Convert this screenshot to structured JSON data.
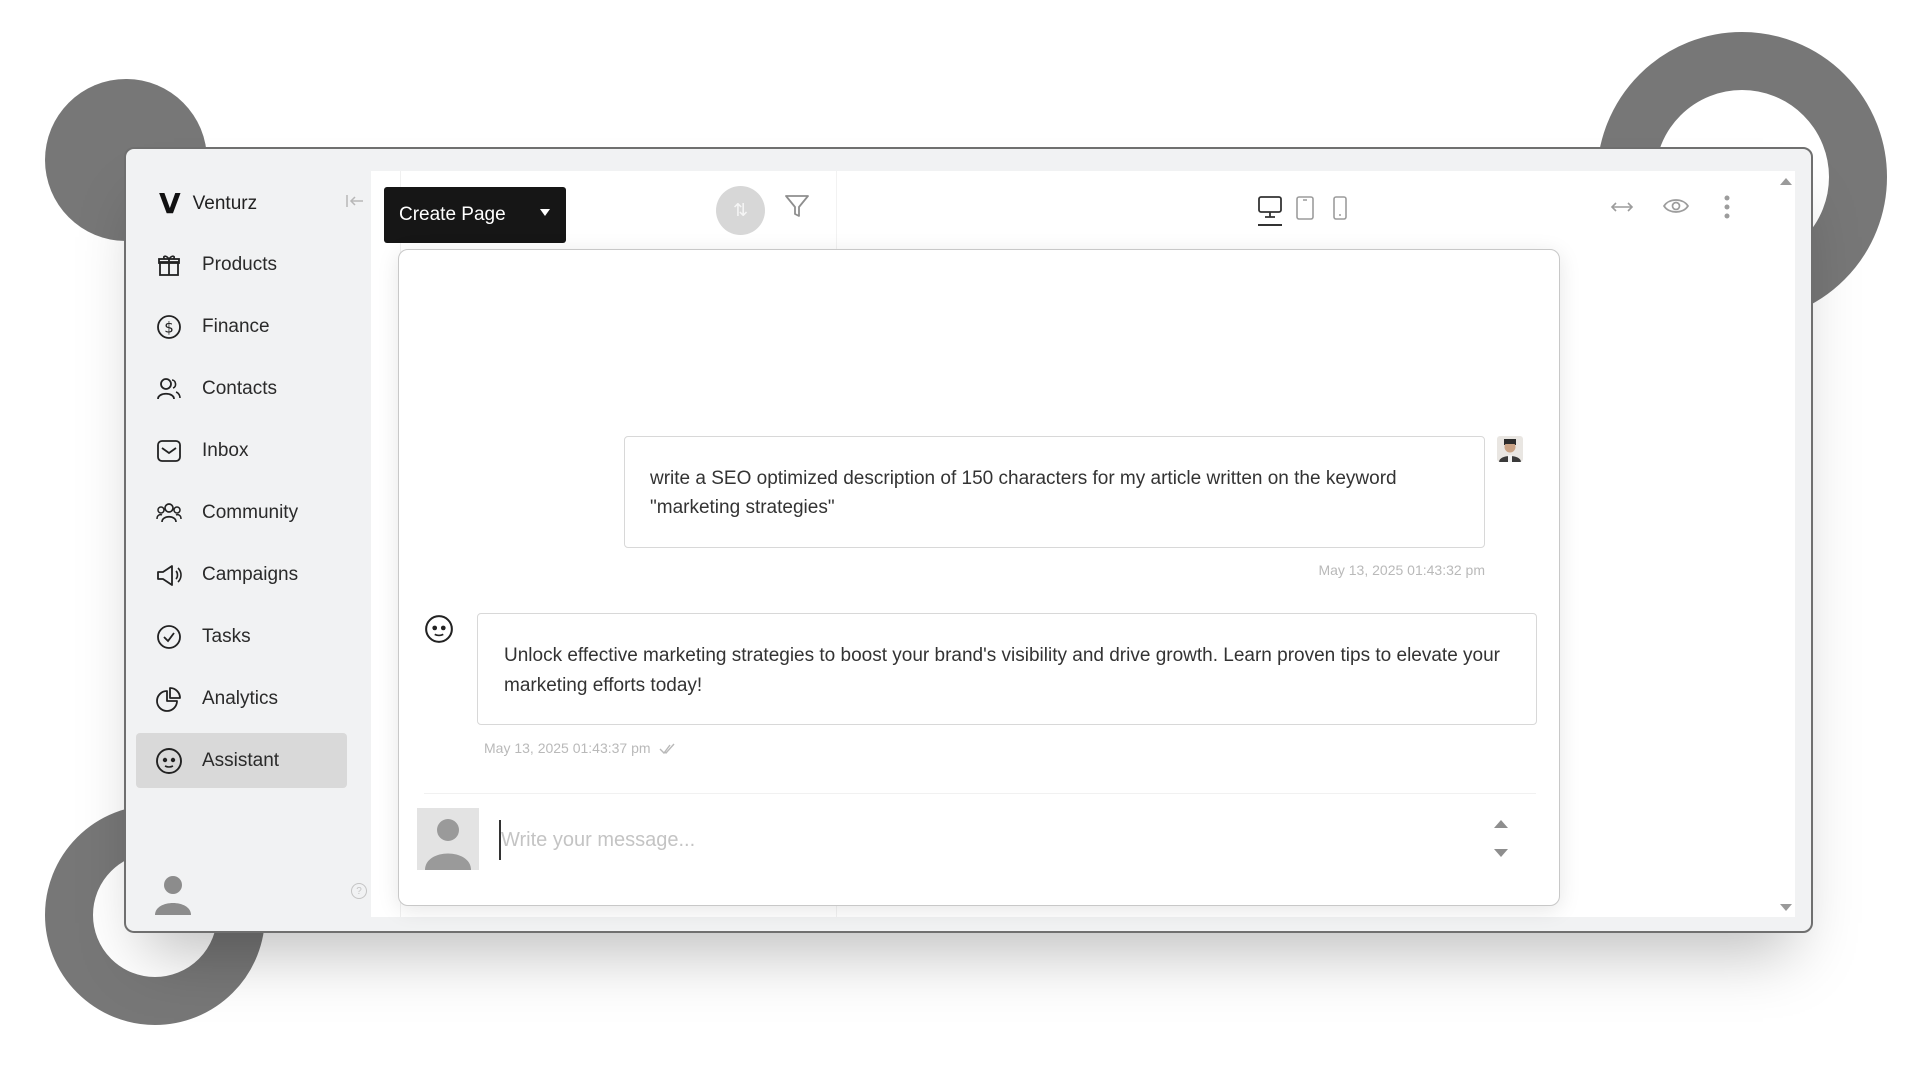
{
  "app": {
    "brand_mark": "V",
    "brand_name": "Venturz"
  },
  "sidebar": {
    "collapse_icon": "collapse-left-icon",
    "items": [
      {
        "label": "Products",
        "icon": "gift-icon",
        "active": false
      },
      {
        "label": "Finance",
        "icon": "dollar-circle-icon",
        "active": false
      },
      {
        "label": "Contacts",
        "icon": "contacts-icon",
        "active": false
      },
      {
        "label": "Inbox",
        "icon": "inbox-icon",
        "active": false
      },
      {
        "label": "Community",
        "icon": "community-icon",
        "active": false
      },
      {
        "label": "Campaigns",
        "icon": "megaphone-icon",
        "active": false
      },
      {
        "label": "Tasks",
        "icon": "check-circle-icon",
        "active": false
      },
      {
        "label": "Analytics",
        "icon": "pie-chart-icon",
        "active": false
      },
      {
        "label": "Assistant",
        "icon": "assistant-face-icon",
        "active": true
      }
    ],
    "help_glyph": "?"
  },
  "toolbar": {
    "create_page_label": "Create Page",
    "sort_glyph": "⇅"
  },
  "chat": {
    "messages": [
      {
        "role": "user",
        "text": "write a SEO optimized description of 150 characters for my article written on the keyword \"marketing strategies\"",
        "time": "May 13, 2025 01:43:32 pm"
      },
      {
        "role": "assistant",
        "text": "Unlock effective marketing strategies to boost your brand's visibility and drive growth. Learn proven tips to elevate your marketing efforts today!",
        "time": "May 13, 2025 01:43:37 pm"
      }
    ],
    "composer": {
      "placeholder": "Write your message...",
      "value": ""
    }
  },
  "colors": {
    "accent_dark": "#161616",
    "sidebar_bg": "#f1f2f3",
    "active_item": "#d9d9d9",
    "decor_gray": "#777777"
  }
}
